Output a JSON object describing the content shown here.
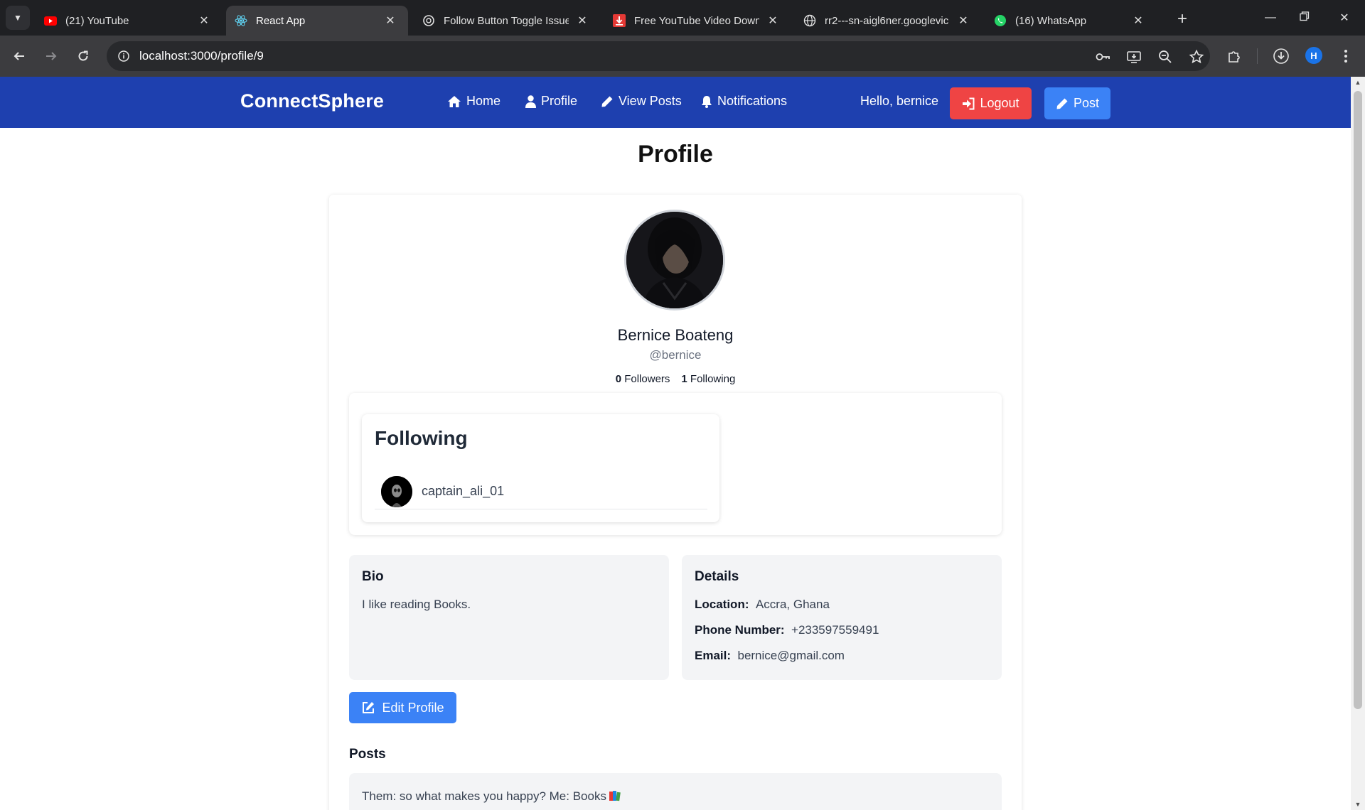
{
  "browser": {
    "tabs": [
      {
        "title": "(21) YouTube",
        "icon": "youtube-icon"
      },
      {
        "title": "React App",
        "icon": "react-icon",
        "active": true
      },
      {
        "title": "Follow Button Toggle Issue",
        "icon": "chatgpt-icon"
      },
      {
        "title": "Free YouTube Video Downl",
        "icon": "download-icon"
      },
      {
        "title": "rr2---sn-aigl6ner.googlevic",
        "icon": "globe-icon"
      },
      {
        "title": "(16) WhatsApp",
        "icon": "whatsapp-icon"
      }
    ],
    "url": "localhost:3000/profile/9",
    "profile_initial": "H"
  },
  "app": {
    "brand": "ConnectSphere",
    "nav": {
      "home": "Home",
      "profile": "Profile",
      "view_posts": "View Posts",
      "notifications": "Notifications"
    },
    "greeting": "Hello, bernice",
    "logout": "Logout",
    "post": "Post",
    "colors": {
      "nav_bg": "#1e40af",
      "logout": "#ef4444",
      "primary": "#3b82f6"
    }
  },
  "profile": {
    "page_title": "Profile",
    "full_name": "Bernice Boateng",
    "username": "@bernice",
    "followers_count": "0",
    "followers_label": "Followers",
    "following_count": "1",
    "following_label": "Following",
    "following_section_title": "Following",
    "following_list": [
      {
        "username": "captain_ali_01"
      }
    ],
    "bio_title": "Bio",
    "bio": "I like reading Books.",
    "details_title": "Details",
    "location_label": "Location:",
    "location": "Accra, Ghana",
    "phone_label": "Phone Number:",
    "phone": "+233597559491",
    "email_label": "Email:",
    "email": "bernice@gmail.com",
    "edit_button": "Edit Profile",
    "posts_title": "Posts",
    "posts": [
      {
        "text": "Them: so what makes you happy? Me: Books"
      }
    ]
  }
}
